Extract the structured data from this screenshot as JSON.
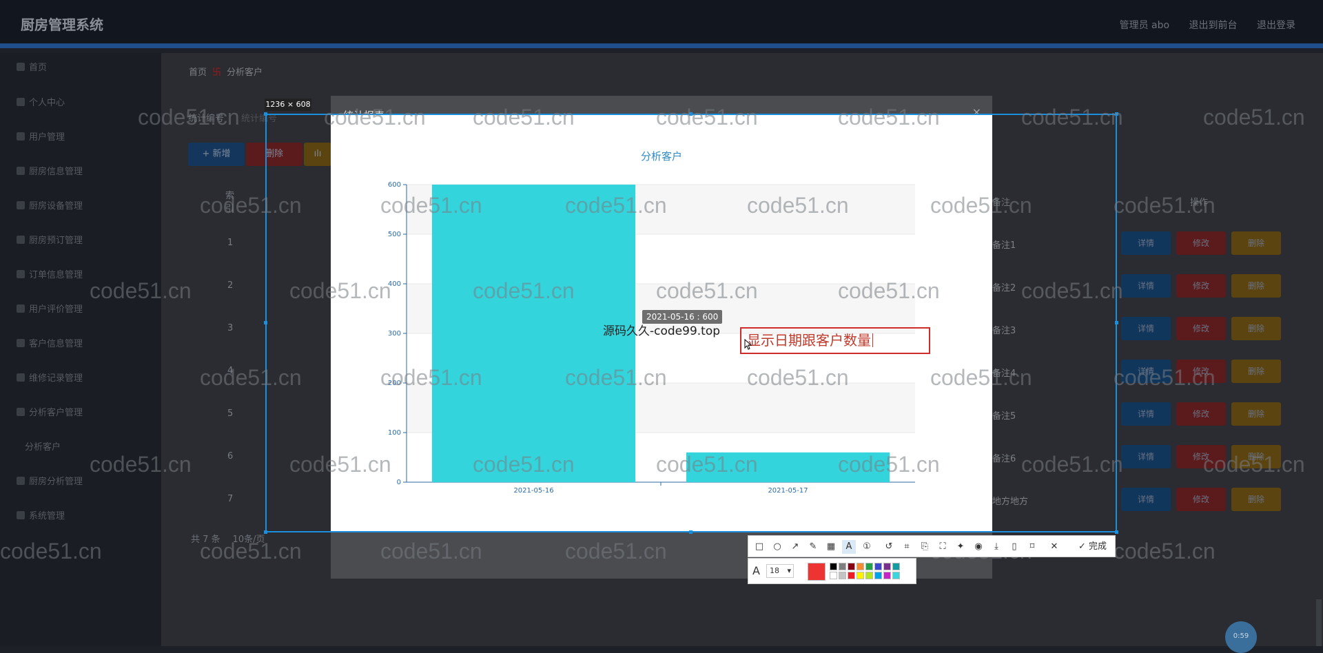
{
  "header": {
    "brand": "厨房管理系统",
    "admin": "管理员 abo",
    "front": "退出到前台",
    "logout": "退出登录"
  },
  "sidebar": {
    "items": [
      {
        "label": "首页"
      },
      {
        "label": "个人中心"
      },
      {
        "label": "用户管理"
      },
      {
        "label": "厨房信息管理"
      },
      {
        "label": "厨房设备管理"
      },
      {
        "label": "厨房预订管理"
      },
      {
        "label": "订单信息管理"
      },
      {
        "label": "用户评价管理"
      },
      {
        "label": "客户信息管理"
      },
      {
        "label": "维修记录管理"
      },
      {
        "label": "分析客户管理"
      },
      {
        "label": "分析客户"
      },
      {
        "label": "厨房分析管理"
      },
      {
        "label": "系统管理"
      }
    ]
  },
  "breadcrumb": {
    "home": "首页",
    "current": "分析客户"
  },
  "search": {
    "label": "统计编号",
    "placeholder": "统计编号"
  },
  "toolbar": {
    "add": "+ 新增",
    "delete": "删除",
    "report": "统计报表"
  },
  "table": {
    "headers": {
      "index": "索引",
      "note": "备注",
      "action": "操作"
    },
    "rows": [
      {
        "no": "1",
        "note": "备注1"
      },
      {
        "no": "2",
        "note": "备注2"
      },
      {
        "no": "3",
        "note": "备注3"
      },
      {
        "no": "4",
        "note": "备注4"
      },
      {
        "no": "5",
        "note": "备注5"
      },
      {
        "no": "6",
        "note": "备注6"
      },
      {
        "no": "7",
        "note": "地方地方"
      }
    ],
    "actions": {
      "detail": "详情",
      "edit": "修改",
      "del": "删除"
    }
  },
  "pager": {
    "total": "共 7 条",
    "per_page": "10条/页"
  },
  "watermark": "code51.cn",
  "modal": {
    "title": "统计报表",
    "close": "×"
  },
  "capture": {
    "size": "1236 × 608"
  },
  "chart_data": {
    "type": "bar",
    "title": "分析客户",
    "categories": [
      "2021-05-16",
      "2021-05-17"
    ],
    "values": [
      600,
      60
    ],
    "ylim": [
      0,
      600
    ],
    "yticks": [
      0,
      100,
      200,
      300,
      400,
      500,
      600
    ],
    "bar_color": "#33d4dc",
    "grid": true
  },
  "tooltip": "2021-05-16 : 600",
  "annotations": {
    "text1": "源码久久-code99.top",
    "text2": "显示日期跟客户数量"
  },
  "screenshot_toolbar": {
    "done": "完成",
    "font_size": "18"
  },
  "timer": "0:59"
}
